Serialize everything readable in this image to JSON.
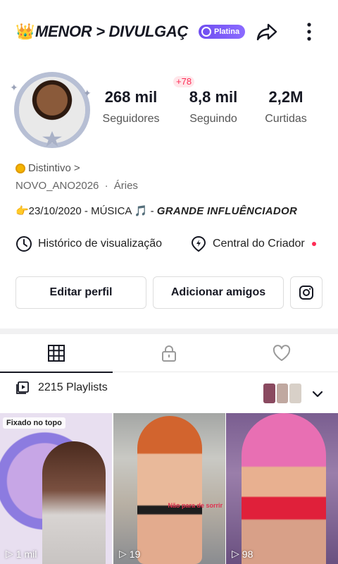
{
  "header": {
    "crown_emoji": "👑",
    "username": "MENOR > DIVULGAÇ",
    "tier_badge": "Platina"
  },
  "profile": {
    "notification_count": "+78",
    "stats": [
      {
        "value": "268 mil",
        "label": "Seguidores"
      },
      {
        "value": "8,8 mil",
        "label": "Seguindo"
      },
      {
        "value": "2,2M",
        "label": "Curtidas"
      }
    ],
    "badge_label": "Distintivo",
    "badge_chevron": ">",
    "handle": "NOVO_ANO2026",
    "separator": "·",
    "zodiac": "Áries",
    "bio_main": "👉23/10/2020 - MÚSICA 🎵 -",
    "bio_bold": "GRANDE INFLUÊNCIADOR"
  },
  "links": {
    "history": "Histórico de visualização",
    "creator_center": "Central do Criador"
  },
  "buttons": {
    "edit_profile": "Editar perfil",
    "add_friends": "Adicionar amigos"
  },
  "tabs": {
    "active": "videos-grid",
    "items": [
      "grid-icon",
      "lock-icon",
      "heart-icon"
    ]
  },
  "playlists": {
    "label": "2215 Playlists"
  },
  "videos": [
    {
      "pinned_label": "Fixado no topo",
      "views": "1 mil"
    },
    {
      "views": "19",
      "caption": "Não para de sorrir"
    },
    {
      "views": "98"
    }
  ],
  "colors": {
    "accent_red": "#fe2c55",
    "platina": "#7b5cf5",
    "text": "#161823"
  }
}
